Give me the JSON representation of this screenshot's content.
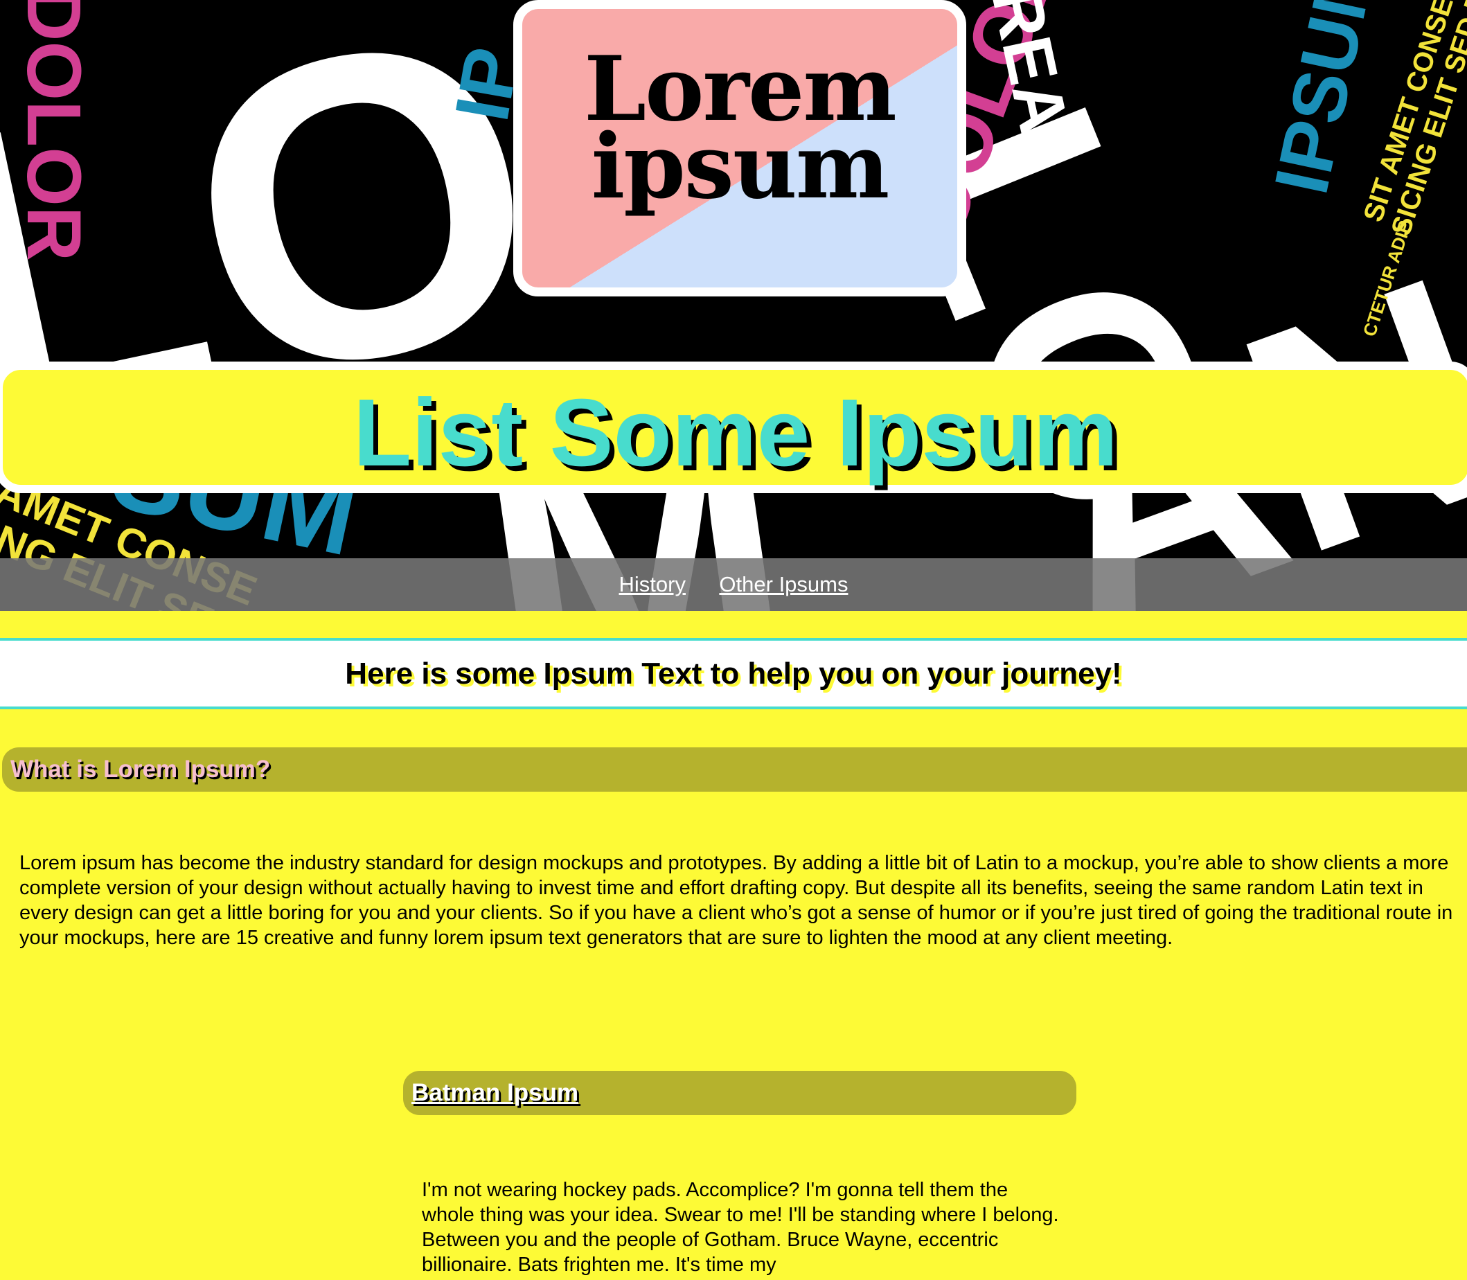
{
  "logo": {
    "line1": "Lorem",
    "line2": "ipsum"
  },
  "header": {
    "title": "List Some Ipsum"
  },
  "nav": {
    "items": [
      {
        "label": "History"
      },
      {
        "label": "Other Ipsums"
      }
    ]
  },
  "tagline": "Here is some Ipsum Text to help you on your journey!",
  "sections": {
    "what": {
      "heading": "What is Lorem Ipsum?",
      "body": "Lorem ipsum has become the industry standard for design mockups and prototypes. By adding a little bit of Latin to a mockup, you’re able to show clients a more complete version of your design without actually having to invest time and effort drafting copy. But despite all its benefits, seeing the same random Latin text in every design can get a little boring for you and your clients. So if you have a client who’s got a sense of humor or if you’re just tired of going the traditional route in your mockups, here are 15 creative and funny lorem ipsum text generators that are sure to lighten the mood at any client meeting."
    },
    "batman": {
      "heading": "Batman Ipsum",
      "body": "I'm not wearing hockey pads. Accomplice? I'm gonna tell them the whole thing was your idea. Swear to me! I'll be standing where I belong. Between you and the people of Gotham. Bruce Wayne, eccentric billionaire. Bats frighten me. It's time my"
    }
  },
  "colors": {
    "page_background": "#fdfa36",
    "title_text": "#48dccd",
    "section_head_bg": "#b5b22d",
    "logo_pink": "#f9aaa9",
    "logo_blue": "#cde0fb",
    "accent_magenta": "#d33f93",
    "accent_blue": "#1a8fb8",
    "accent_yellow": "#f2e33a"
  }
}
